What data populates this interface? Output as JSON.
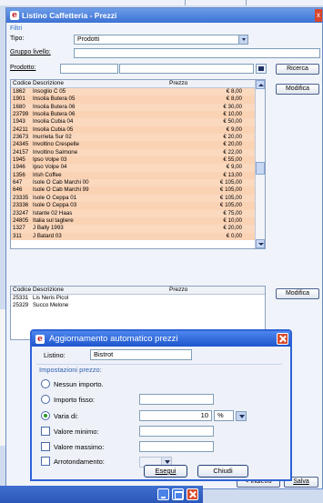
{
  "window": {
    "title": "Listino Caffetteria - Prezzi"
  },
  "filters": {
    "section_label": "Filtri",
    "tipo_label": "Tipo:",
    "tipo_value": "Prodotti",
    "gruppo_label": "Gruppo livello:",
    "gruppo_value": "",
    "prodotto_label": "Prodotto:",
    "prodotto_code": "",
    "prodotto_desc": "",
    "ricerca_button": "Ricerca"
  },
  "grid1": {
    "headers": [
      "Codice",
      "Descrizione",
      "Prezzo"
    ],
    "rows": [
      [
        "1862",
        "Insoglio C 05",
        "€ 8,00"
      ],
      [
        "1901",
        "Insolia Butera 05",
        "€ 8,00"
      ],
      [
        "1680",
        "Insolia Butera 06",
        "€ 30,00"
      ],
      [
        "23799",
        "Insolia Butera 06",
        "€ 10,00"
      ],
      [
        "1943",
        "Insolia Cubia 04",
        "€ 50,00"
      ],
      [
        "24211",
        "Insolia Cubia 05",
        "€ 9,00"
      ],
      [
        "23673",
        "Inurrieta Sur 02",
        "€ 20,00"
      ],
      [
        "24345",
        "Involtino Crespelle",
        "€ 20,00"
      ],
      [
        "24157",
        "Involtino Salmone",
        "€ 22,00"
      ],
      [
        "1945",
        "Ipso Volpe 03",
        "€ 55,00"
      ],
      [
        "1946",
        "Ipso Volpe 04",
        "€ 9,00"
      ],
      [
        "1356",
        "Irish Coffee",
        "€ 13,00"
      ],
      [
        "647",
        "Isole O Cab Marchi 00",
        "€ 105,00"
      ],
      [
        "646",
        "Isole O Cab Marchi 99",
        "€ 105,00"
      ],
      [
        "23335",
        "Isole O Ceppa 01",
        "€ 105,00"
      ],
      [
        "23336",
        "Isole O Ceppa 03",
        "€ 105,00"
      ],
      [
        "23247",
        "Istante 02 Haas",
        "€ 75,00"
      ],
      [
        "24805",
        "Italia sul tagliere",
        "€ 10,00"
      ],
      [
        "1327",
        "J Bally 1993",
        "€ 20,00"
      ],
      [
        "311",
        "J Batard 03",
        "€ 0,00"
      ]
    ],
    "modifica_button": "Modifica"
  },
  "grid2": {
    "headers": [
      "Codice",
      "Descrizione",
      "Prezzo"
    ],
    "rows": [
      [
        "25331",
        "Lis Neris Picol",
        ""
      ],
      [
        "25329",
        "Succo Melone",
        ""
      ]
    ],
    "modifica_button": "Modifica"
  },
  "dialog": {
    "title": "Aggiornamento automatico prezzi",
    "listino_label": "Listino:",
    "listino_value": "Bistrot",
    "section_label": "Impostazioni prezzo:",
    "opt_none": "Nessun importo.",
    "opt_fixed": "Importo fisso:",
    "opt_varia": "Varia di:",
    "varia_value": "10",
    "varia_unit": "%",
    "chk_min": "Valore minimo:",
    "chk_max": "Valore massimo:",
    "chk_round": "Arrotondamento:",
    "esegui_button": "Esegui",
    "chiudi_button": "Chiudi"
  },
  "footer": {
    "indietro_button": "< Indietro",
    "salva_button": "Salva"
  },
  "colors": {
    "row_highlight": "#fbd9bf",
    "title_blue": "#2d62d6",
    "close_red": "#d84b2c"
  }
}
